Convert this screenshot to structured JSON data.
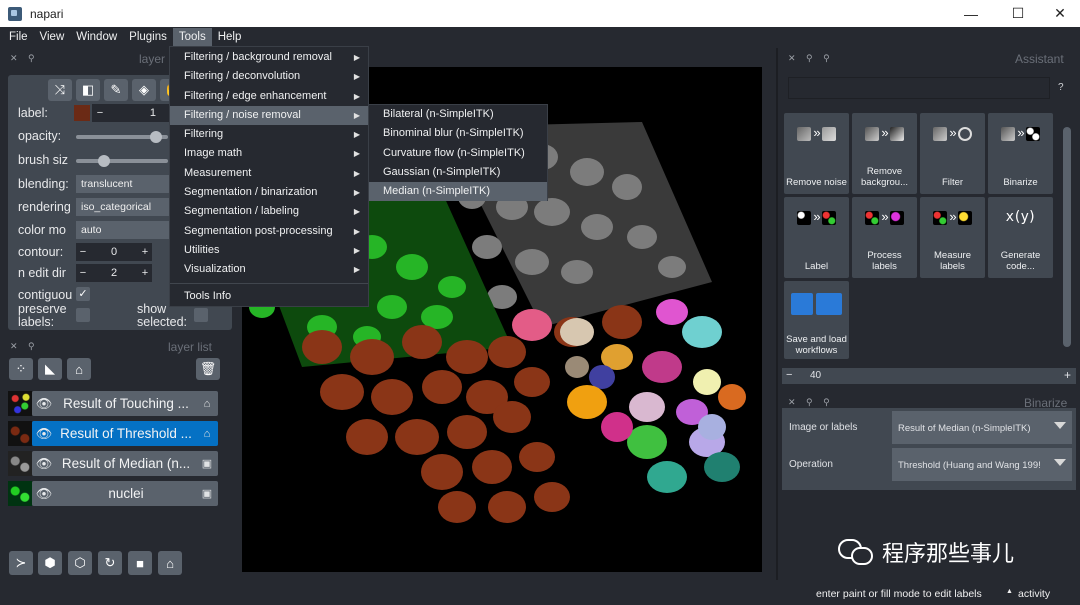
{
  "window": {
    "title": "napari",
    "minimize": "—",
    "maximize": "☐",
    "close": "✕"
  },
  "menubar": [
    "File",
    "View",
    "Window",
    "Plugins",
    "Tools",
    "Help"
  ],
  "layer_controls": {
    "title": "layer",
    "label_label": "label:",
    "label_value": "1",
    "label_minus": "−",
    "opacity_label": "opacity:",
    "brush_label": "brush siz",
    "blending_label": "blending:",
    "blending_value": "translucent",
    "rendering_label": "rendering",
    "rendering_value": "iso_categorical",
    "color_label": "color mo",
    "color_value": "auto",
    "contour_label": "contour:",
    "contour_value": "0",
    "edit_dim_label": "n edit dir",
    "edit_dim_value": "2",
    "contiguous_label": "contiguou",
    "preserve_label": "preserve labels:",
    "show_selected_label": "show selected:",
    "spin_minus": "−",
    "spin_plus": "+",
    "check": "✓",
    "colors": {
      "label_swatch": "#6b2a15"
    }
  },
  "layer_list": {
    "title": "layer list",
    "layers": [
      {
        "name": "Result of Touching ...",
        "type_icon": "tag-icon",
        "selected": false
      },
      {
        "name": "Result of Threshold ...",
        "type_icon": "tag-icon",
        "selected": true
      },
      {
        "name": "Result of Median (n...",
        "type_icon": "image-icon",
        "selected": false
      },
      {
        "name": "nuclei",
        "type_icon": "image-icon",
        "selected": false
      }
    ]
  },
  "tools_menu": {
    "items": [
      {
        "label": "Filtering / background removal",
        "submenu": true
      },
      {
        "label": "Filtering / deconvolution",
        "submenu": true
      },
      {
        "label": "Filtering / edge enhancement",
        "submenu": true
      },
      {
        "label": "Filtering / noise removal",
        "submenu": true,
        "highlighted": true
      },
      {
        "label": "Filtering",
        "submenu": true
      },
      {
        "label": "Image math",
        "submenu": true
      },
      {
        "label": "Measurement",
        "submenu": true
      },
      {
        "label": "Segmentation / binarization",
        "submenu": true
      },
      {
        "label": "Segmentation / labeling",
        "submenu": true
      },
      {
        "label": "Segmentation post-processing",
        "submenu": true
      },
      {
        "label": "Utilities",
        "submenu": true
      },
      {
        "label": "Visualization",
        "submenu": true
      },
      {
        "label": "Tools Info",
        "submenu": false
      }
    ],
    "arrow": "▶"
  },
  "noise_submenu": {
    "items": [
      {
        "label": "Bilateral (n-SimpleITK)",
        "highlighted": false
      },
      {
        "label": "Binominal blur (n-SimpleITK)",
        "highlighted": false
      },
      {
        "label": "Curvature flow (n-SimpleITK)",
        "highlighted": false
      },
      {
        "label": "Gaussian (n-SimpleITK)",
        "highlighted": false
      },
      {
        "label": "Median (n-SimpleITK)",
        "highlighted": true
      }
    ]
  },
  "assistant": {
    "title": "Assistant",
    "help": "?",
    "tiles": [
      {
        "label": "Remove noise",
        "icon": "▨»▨"
      },
      {
        "label": "Remove backgrou...",
        "icon": "▨»▨"
      },
      {
        "label": "Filter",
        "icon": "▨»∿"
      },
      {
        "label": "Binarize",
        "icon": "▨»◼"
      },
      {
        "label": "Label",
        "icon": "▦»▦"
      },
      {
        "label": "Process labels",
        "icon": "▦»▦"
      },
      {
        "label": "Measure labels",
        "icon": "▦»▥"
      },
      {
        "label": "Generate code...",
        "icon": "x(y)"
      },
      {
        "label": "Save and load workflows",
        "icon": "💾📁"
      }
    ],
    "zoom_value": "40",
    "zoom_minus": "−",
    "zoom_plus": "+"
  },
  "binarize": {
    "title": "Binarize",
    "image_label": "Image or labels",
    "image_value": "Result of Median (n-SimpleITK)",
    "operation_label": "Operation",
    "operation_value": "Threshold (Huang and Wang 199!"
  },
  "status": {
    "message": "enter paint or fill mode to edit labels",
    "activity": "activity",
    "activity_arrow": "▲"
  },
  "watermark": {
    "text": "程序那些事儿"
  }
}
